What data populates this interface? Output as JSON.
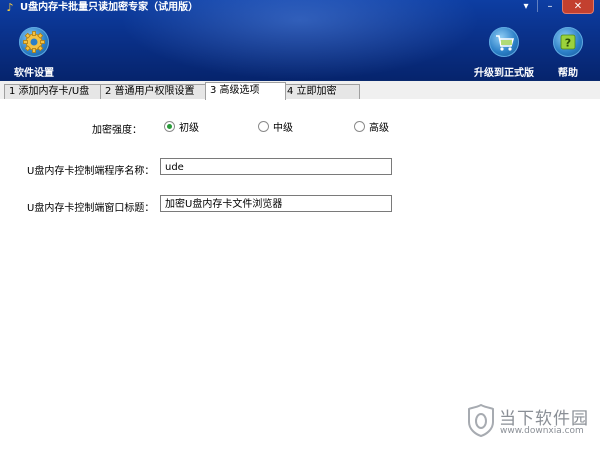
{
  "window": {
    "title": "U盘内存卡批量只读加密专家（试用版）",
    "controls": {
      "dropdown": "▾",
      "minimize": "–",
      "close": "✕"
    }
  },
  "toolbar": {
    "settings_label": "软件设置",
    "upgrade_label": "升级到正式版",
    "help_label": "帮助",
    "icons": {
      "settings": "gear-icon",
      "upgrade": "cart-icon",
      "help": "help-icon"
    }
  },
  "tabs": [
    {
      "label": "1 添加内存卡/U盘",
      "active": false
    },
    {
      "label": "2 普通用户权限设置",
      "active": false
    },
    {
      "label": "3 高级选项",
      "active": true
    },
    {
      "label": "4 立即加密",
      "active": false
    }
  ],
  "advanced": {
    "strength_label": "加密强度：",
    "strength_options": [
      {
        "label": "初级",
        "selected": true
      },
      {
        "label": "中级",
        "selected": false
      },
      {
        "label": "高级",
        "selected": false
      }
    ],
    "program_name_label": "U盘内存卡控制端程序名称：",
    "program_name_value": "ude",
    "window_title_label": "U盘内存卡控制端窗口标题：",
    "window_title_value": "加密U盘内存卡文件浏览器"
  },
  "watermark": {
    "brand": "当下软件园",
    "url": "www.downxia.com"
  },
  "colors": {
    "header": "#0a318a",
    "radio_selected": "#2a9a3a",
    "close_button": "#c3402f"
  }
}
